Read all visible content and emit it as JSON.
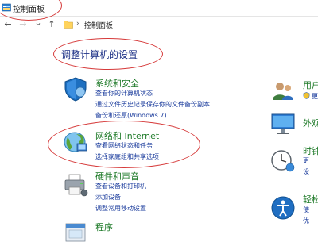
{
  "window": {
    "title": "控制面板"
  },
  "address": {
    "path_item": "控制面板",
    "separator": "›"
  },
  "nav": {
    "back": "←",
    "forward": "→",
    "history": "⌄",
    "up": "↑"
  },
  "main": {
    "heading": "调整计算机的设置",
    "categories": [
      {
        "title": "系统和安全",
        "links": [
          "查看你的计算机状态",
          "通过文件历史记录保存你的文件备份副本",
          "备份和还原(Windows 7)"
        ]
      },
      {
        "title": "网络和 Internet",
        "links": [
          "查看网络状态和任务",
          "选择家庭组和共享选项"
        ]
      },
      {
        "title": "硬件和声音",
        "links": [
          "查看设备和打印机",
          "添加设备",
          "调整常用移动设置"
        ]
      },
      {
        "title": "程序",
        "links": []
      }
    ],
    "right_column": [
      {
        "title": "用户",
        "links": [
          "更"
        ]
      },
      {
        "title": "外观",
        "links": []
      },
      {
        "title": "时钟",
        "links": [
          "更",
          "设"
        ]
      },
      {
        "title": "轻松",
        "links": [
          "使",
          "优"
        ]
      }
    ]
  },
  "colors": {
    "link": "#1a3b9c",
    "category_title": "#1e7a28",
    "heading": "#1e3287",
    "annotation_ellipse": "#d63a3a"
  }
}
